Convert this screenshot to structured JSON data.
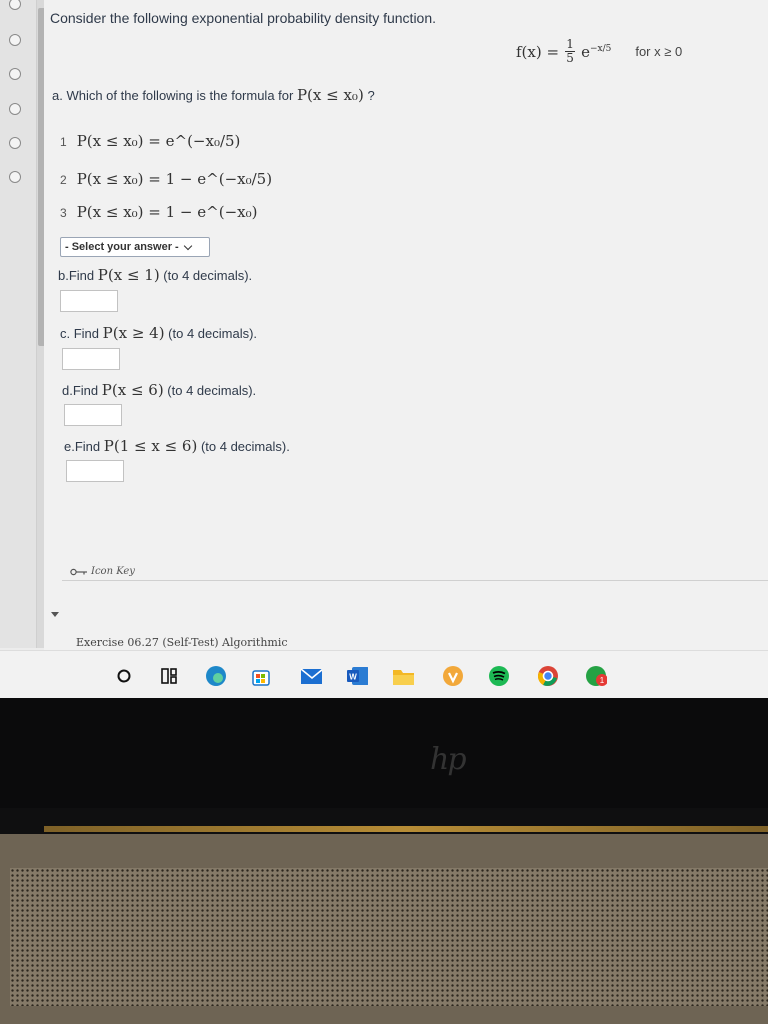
{
  "intro": "Consider the following exponential probability density function.",
  "density": {
    "lhs": "f(x) =",
    "numerator": "1",
    "denominator": "5",
    "exp_base": "e",
    "exponent": "−x/5",
    "condition": "for  x ≥ 0"
  },
  "question_a": {
    "prefix": "a. Which of the following is the formula for",
    "expr": "P(x ≤ x₀)",
    "suffix": "?"
  },
  "options": [
    {
      "num": "1",
      "formula": "P(x ≤ x₀) = e^(−x₀/5)"
    },
    {
      "num": "2",
      "formula": "P(x ≤ x₀) = 1 − e^(−x₀/5)"
    },
    {
      "num": "3",
      "formula": "P(x ≤ x₀) = 1 − e^(−x₀)"
    }
  ],
  "select": {
    "label": "- Select your answer -"
  },
  "questions": [
    {
      "label": "b.Find",
      "expr": "P(x ≤ 1)",
      "suffix": "(to 4 decimals)."
    },
    {
      "label": "c. Find",
      "expr": "P(x ≥ 4)",
      "suffix": "(to 4 decimals)."
    },
    {
      "label": "d.Find",
      "expr": "P(x ≤ 6)",
      "suffix": "(to 4 decimals)."
    },
    {
      "label": "e.Find",
      "expr": "P(1 ≤ x ≤ 6)",
      "suffix": "(to 4 decimals)."
    }
  ],
  "icon_key": "Icon Key",
  "footer": "Exercise 06.27 (Self-Test) Algorithmic",
  "taskbar": {
    "badge_count": "1",
    "word_letter": "W"
  },
  "brand_logo": "hp"
}
